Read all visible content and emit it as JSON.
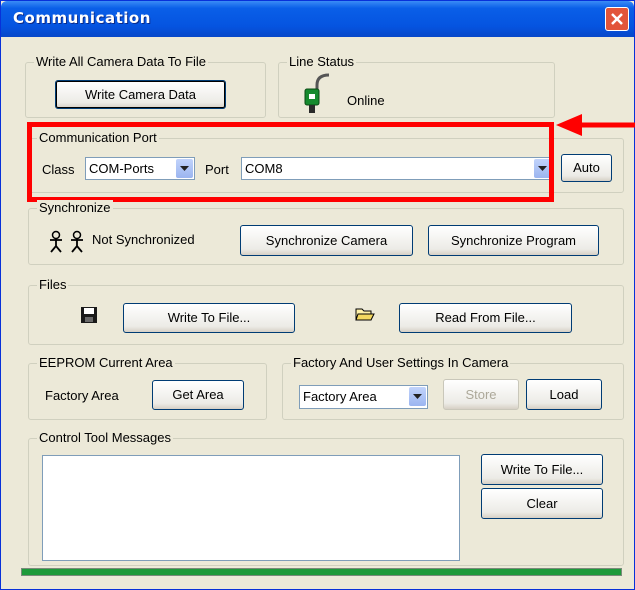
{
  "window": {
    "title": "Communication"
  },
  "write_all": {
    "group_label": "Write All Camera Data To File",
    "button": "Write Camera Data"
  },
  "line_status": {
    "group_label": "Line Status",
    "status": "Online"
  },
  "comm_port": {
    "group_label": "Communication Port",
    "class_label": "Class",
    "class_value": "COM-Ports",
    "port_label": "Port",
    "port_value": "COM8",
    "auto_button": "Auto"
  },
  "synchronize": {
    "group_label": "Synchronize",
    "status": "Not Synchronized",
    "sync_camera_button": "Synchronize Camera",
    "sync_program_button": "Synchronize Program"
  },
  "files": {
    "group_label": "Files",
    "write_button": "Write To File...",
    "read_button": "Read From File..."
  },
  "eeprom": {
    "group_label": "EEPROM Current Area",
    "value": "Factory Area",
    "get_button": "Get Area"
  },
  "factory_user": {
    "group_label": "Factory And User Settings In Camera",
    "select_value": "Factory Area",
    "store_button": "Store",
    "load_button": "Load"
  },
  "messages": {
    "group_label": "Control Tool Messages",
    "write_button": "Write To File...",
    "clear_button": "Clear"
  },
  "colors": {
    "highlight": "#ff0000",
    "titlebar": "#0554e0",
    "progress": "#1e9a3a"
  }
}
